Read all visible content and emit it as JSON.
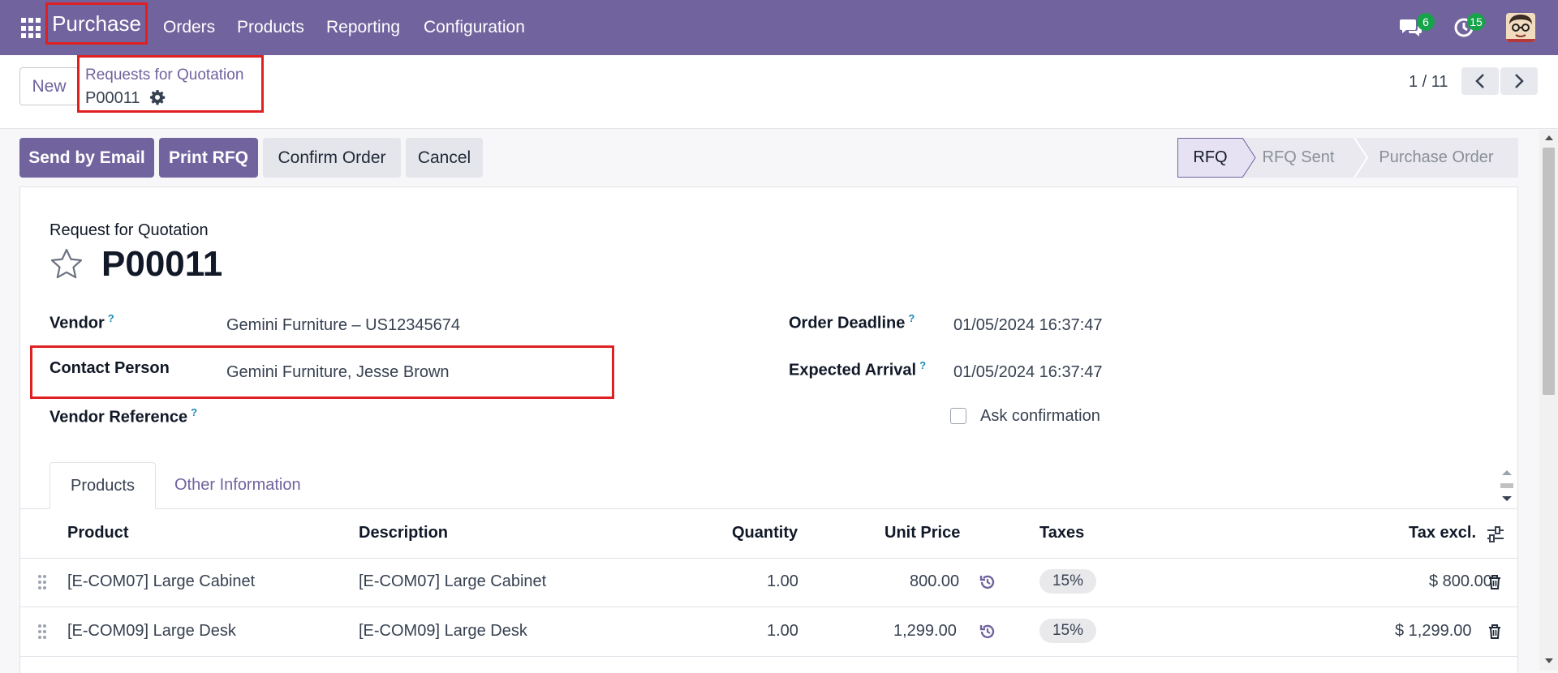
{
  "topbar": {
    "app_name": "Purchase",
    "nav": [
      "Orders",
      "Products",
      "Reporting",
      "Configuration"
    ],
    "messages_count": "6",
    "activities_count": "15"
  },
  "control": {
    "new_label": "New",
    "breadcrumb_parent": "Requests for Quotation",
    "breadcrumb_current": "P00011",
    "pager": "1 / 11"
  },
  "actions": {
    "send_email": "Send by Email",
    "print_rfq": "Print RFQ",
    "confirm_order": "Confirm Order",
    "cancel": "Cancel"
  },
  "status_stages": [
    "RFQ",
    "RFQ Sent",
    "Purchase Order"
  ],
  "form": {
    "doc_type": "Request for Quotation",
    "doc_name": "P00011",
    "vendor_label": "Vendor",
    "vendor_value": "Gemini Furniture – US12345674",
    "contact_label": "Contact Person",
    "contact_value": "Gemini Furniture, Jesse Brown",
    "vendor_ref_label": "Vendor Reference",
    "order_deadline_label": "Order Deadline",
    "order_deadline_value": "01/05/2024 16:37:47",
    "expected_arrival_label": "Expected Arrival",
    "expected_arrival_value": "01/05/2024 16:37:47",
    "ask_confirmation_label": "Ask confirmation",
    "help_mark": "?"
  },
  "tabs": [
    "Products",
    "Other Information"
  ],
  "table": {
    "headers": [
      "Product",
      "Description",
      "Quantity",
      "Unit Price",
      "Taxes",
      "Tax excl."
    ],
    "rows": [
      {
        "product": "[E-COM07] Large Cabinet",
        "description": "[E-COM07] Large Cabinet",
        "quantity": "1.00",
        "unit_price": "800.00",
        "tax": "15%",
        "subtotal": "$ 800.00"
      },
      {
        "product": "[E-COM09] Large Desk",
        "description": "[E-COM09] Large Desk",
        "quantity": "1.00",
        "unit_price": "1,299.00",
        "tax": "15%",
        "subtotal": "$ 1,299.00"
      }
    ]
  },
  "colors": {
    "brand": "#71639e",
    "highlight": "#e02020",
    "badge": "#17a34a"
  }
}
